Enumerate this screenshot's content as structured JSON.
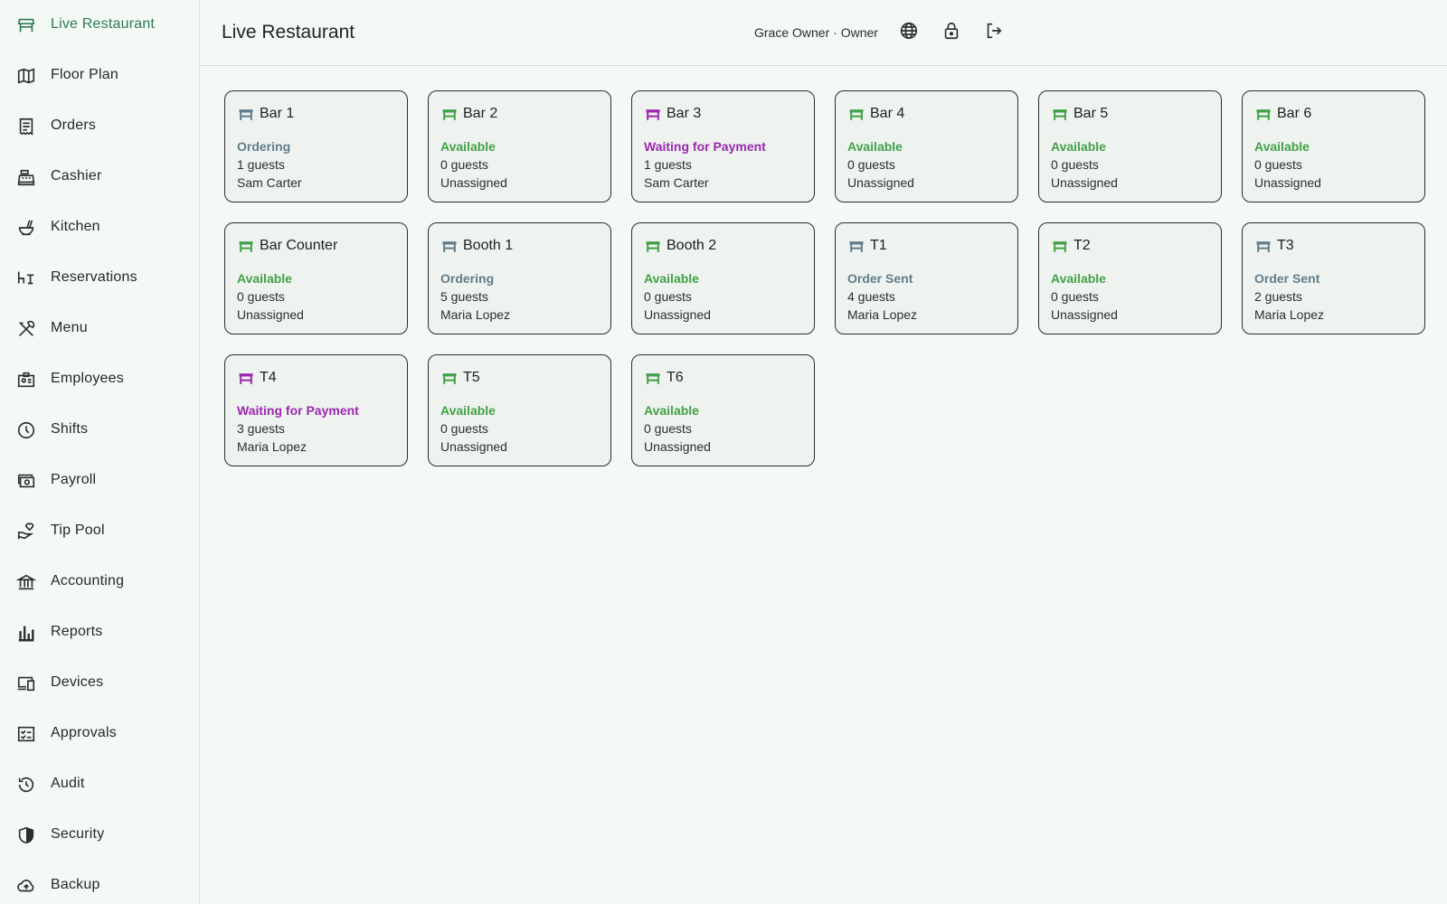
{
  "app": {
    "title": "Live Restaurant",
    "user_label": "Grace Owner · Owner"
  },
  "sidebar": {
    "items": [
      {
        "label": "Live Restaurant",
        "icon": "storefront-icon",
        "active": true
      },
      {
        "label": "Floor Plan",
        "icon": "map-icon"
      },
      {
        "label": "Orders",
        "icon": "receipt-icon"
      },
      {
        "label": "Cashier",
        "icon": "cash-register-icon"
      },
      {
        "label": "Kitchen",
        "icon": "soup-kitchen-icon"
      },
      {
        "label": "Reservations",
        "icon": "table-chair-icon"
      },
      {
        "label": "Menu",
        "icon": "utensils-icon"
      },
      {
        "label": "Employees",
        "icon": "badge-icon"
      },
      {
        "label": "Shifts",
        "icon": "clock-icon"
      },
      {
        "label": "Payroll",
        "icon": "payments-icon"
      },
      {
        "label": "Tip Pool",
        "icon": "hand-heart-icon"
      },
      {
        "label": "Accounting",
        "icon": "bank-icon"
      },
      {
        "label": "Reports",
        "icon": "bar-chart-icon"
      },
      {
        "label": "Devices",
        "icon": "devices-icon"
      },
      {
        "label": "Approvals",
        "icon": "checklist-icon"
      },
      {
        "label": "Audit",
        "icon": "history-icon"
      },
      {
        "label": "Security",
        "icon": "shield-icon"
      },
      {
        "label": "Backup",
        "icon": "cloud-upload-icon"
      }
    ]
  },
  "toolbar": {
    "language_icon": "globe-icon",
    "lock_icon": "lock-icon",
    "logout_icon": "logout-icon"
  },
  "status_colors": {
    "Available": "#43a047",
    "Ordering": "#607d8b",
    "Waiting for Payment": "#9c27b0",
    "Order Sent": "#607d8b"
  },
  "tables": [
    {
      "name": "Bar 1",
      "status": "Ordering",
      "guests": "1 guests",
      "server": "Sam Carter"
    },
    {
      "name": "Bar 2",
      "status": "Available",
      "guests": "0 guests",
      "server": "Unassigned"
    },
    {
      "name": "Bar 3",
      "status": "Waiting for Payment",
      "guests": "1 guests",
      "server": "Sam Carter"
    },
    {
      "name": "Bar 4",
      "status": "Available",
      "guests": "0 guests",
      "server": "Unassigned"
    },
    {
      "name": "Bar 5",
      "status": "Available",
      "guests": "0 guests",
      "server": "Unassigned"
    },
    {
      "name": "Bar 6",
      "status": "Available",
      "guests": "0 guests",
      "server": "Unassigned"
    },
    {
      "name": "Bar Counter",
      "status": "Available",
      "guests": "0 guests",
      "server": "Unassigned"
    },
    {
      "name": "Booth 1",
      "status": "Ordering",
      "guests": "5 guests",
      "server": "Maria Lopez"
    },
    {
      "name": "Booth 2",
      "status": "Available",
      "guests": "0 guests",
      "server": "Unassigned"
    },
    {
      "name": "T1",
      "status": "Order Sent",
      "guests": "4 guests",
      "server": "Maria Lopez"
    },
    {
      "name": "T2",
      "status": "Available",
      "guests": "0 guests",
      "server": "Unassigned"
    },
    {
      "name": "T3",
      "status": "Order Sent",
      "guests": "2 guests",
      "server": "Maria Lopez"
    },
    {
      "name": "T4",
      "status": "Waiting for Payment",
      "guests": "3 guests",
      "server": "Maria Lopez"
    },
    {
      "name": "T5",
      "status": "Available",
      "guests": "0 guests",
      "server": "Unassigned"
    },
    {
      "name": "T6",
      "status": "Available",
      "guests": "0 guests",
      "server": "Unassigned"
    }
  ]
}
